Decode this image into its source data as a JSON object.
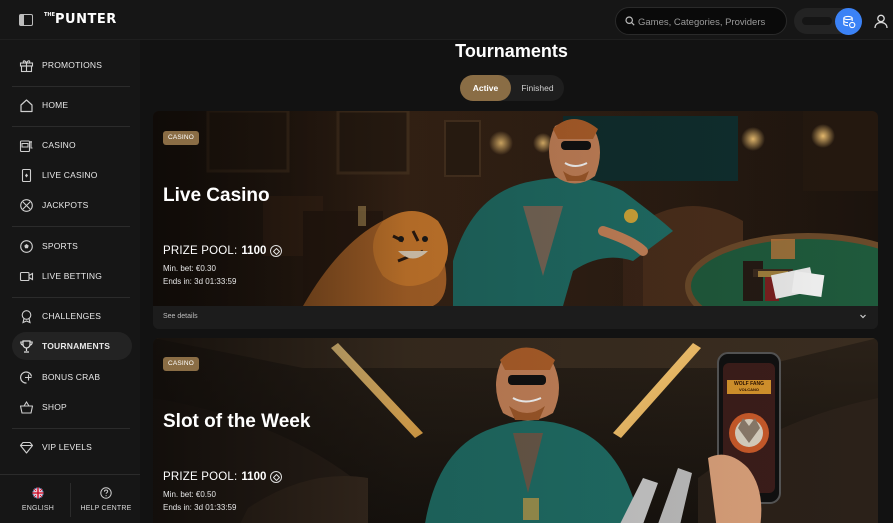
{
  "app": {
    "logo": "PUNTER",
    "logo_prefix": "THE"
  },
  "search": {
    "placeholder": "Games, Categories, Providers"
  },
  "sidebar": {
    "items": [
      {
        "label": "PROMOTIONS",
        "icon": "gift-icon"
      },
      {
        "label": "HOME",
        "icon": "home-icon"
      },
      {
        "label": "CASINO",
        "icon": "slot-machine-icon"
      },
      {
        "label": "LIVE CASINO",
        "icon": "card-icon"
      },
      {
        "label": "JACKPOTS",
        "icon": "jackpot-icon"
      },
      {
        "label": "SPORTS",
        "icon": "soccer-ball-icon"
      },
      {
        "label": "LIVE BETTING",
        "icon": "live-video-icon"
      },
      {
        "label": "CHALLENGES",
        "icon": "medal-icon"
      },
      {
        "label": "TOURNAMENTS",
        "icon": "trophy-icon"
      },
      {
        "label": "BONUS CRAB",
        "icon": "crab-icon"
      },
      {
        "label": "SHOP",
        "icon": "basket-icon"
      },
      {
        "label": "VIP LEVELS",
        "icon": "diamond-icon"
      }
    ],
    "footer": {
      "language": "ENGLISH",
      "help": "HELP CENTRE"
    }
  },
  "main": {
    "title": "Tournaments",
    "tabs": [
      {
        "label": "Active"
      },
      {
        "label": "Finished"
      }
    ],
    "cards": [
      {
        "tag": "CASINO",
        "title": "Live Casino",
        "prize_label": "PRIZE POOL:",
        "prize_value": "1100",
        "min_bet": "Min. bet: €0.30",
        "ends_in": "Ends in: 3d 01:33:59",
        "see_details": "See details"
      },
      {
        "tag": "CASINO",
        "title": "Slot of the Week",
        "prize_label": "PRIZE POOL:",
        "prize_value": "1100",
        "min_bet": "Min. bet: €0.50",
        "ends_in": "Ends in: 3d 01:33:59",
        "phone_game_title": "WOLF FANG",
        "phone_game_subtitle": "VOLCANO"
      }
    ]
  },
  "colors": {
    "accent": "#8a6d45",
    "wallet": "#3b82f6",
    "table_green": "#1f5a3c",
    "suit_teal": "#1f6e66"
  }
}
